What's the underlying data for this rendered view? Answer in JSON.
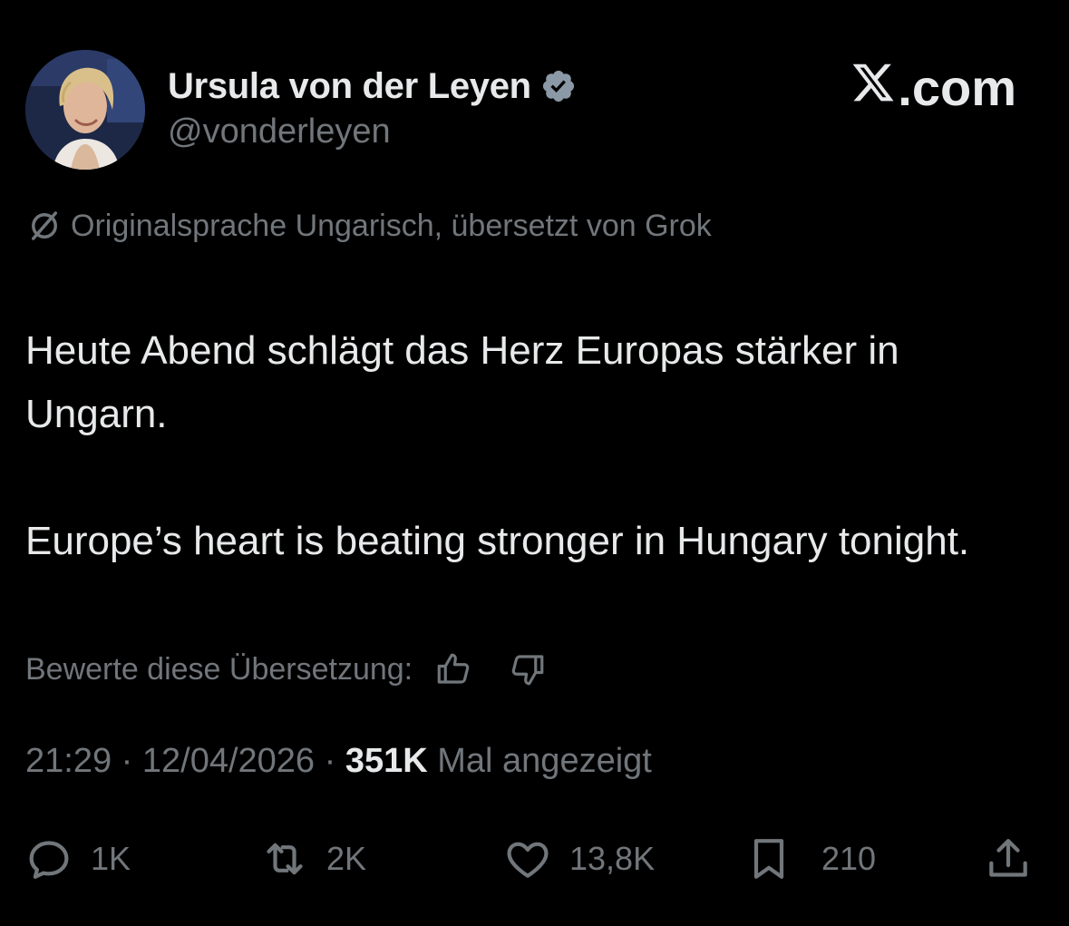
{
  "brand": {
    "label": "𝕏.com",
    "wordmark": ".com"
  },
  "author": {
    "display_name": "Ursula von der Leyen",
    "handle": "@vonderleyen",
    "verified_color": "#8b98a5"
  },
  "translation": {
    "notice": "Originalsprache Ungarisch, übersetzt von Grok"
  },
  "post": {
    "paragraphs": [
      "Heute Abend schlägt das Herz Europas stärker in Ungarn.",
      "Europe’s heart is beating stronger in Hungary tonight."
    ]
  },
  "rating": {
    "label": "Bewerte diese Übersetzung:"
  },
  "meta": {
    "time": "21:29",
    "separator": "·",
    "date": "12/04/2026",
    "views_count": "351K",
    "views_label": "Mal angezeigt"
  },
  "actions": {
    "replies": "1K",
    "reposts": "2K",
    "likes": "13,8K",
    "bookmarks": "210"
  },
  "colors": {
    "background": "#000000",
    "text_primary": "#e7e9ea",
    "text_secondary": "#71767b"
  }
}
